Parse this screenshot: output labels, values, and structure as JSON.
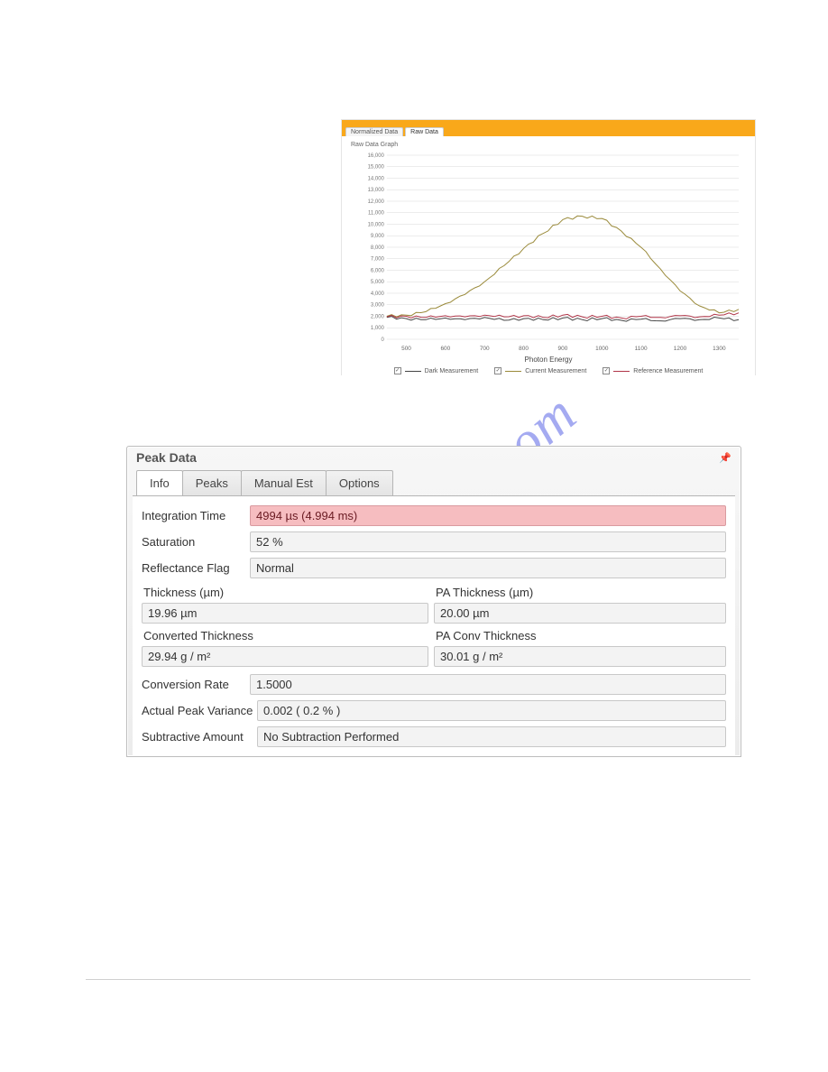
{
  "watermark_text": "manualshive.com",
  "chart_panel": {
    "tabs": [
      {
        "label": "Normalized Data",
        "active": false
      },
      {
        "label": "Raw Data",
        "active": true
      }
    ],
    "subtitle": "Raw Data Graph",
    "xlabel": "Photon Energy",
    "legend": [
      {
        "label": "Dark Measurement",
        "color": "#444444"
      },
      {
        "label": "Current Measurement",
        "color": "#9a8a3a"
      },
      {
        "label": "Reference Measurement",
        "color": "#b03548"
      }
    ]
  },
  "chart_data": {
    "type": "line",
    "title": "Raw Data Graph",
    "xlabel": "Photon Energy",
    "ylabel": "",
    "xlim": [
      450,
      1350
    ],
    "ylim": [
      0,
      16000
    ],
    "y_ticks": [
      0,
      1000,
      2000,
      3000,
      4000,
      5000,
      6000,
      7000,
      8000,
      9000,
      10000,
      11000,
      12000,
      13000,
      14000,
      15000,
      16000
    ],
    "x_ticks": [
      500,
      600,
      700,
      800,
      900,
      1000,
      1100,
      1200,
      1300
    ],
    "series": [
      {
        "name": "Dark Measurement",
        "color": "#444444",
        "x": [
          450,
          500,
          550,
          600,
          650,
          700,
          750,
          800,
          850,
          900,
          950,
          1000,
          1050,
          1100,
          1150,
          1200,
          1250,
          1300,
          1350
        ],
        "values": [
          1900,
          1800,
          1700,
          1850,
          1700,
          1900,
          1650,
          1800,
          1700,
          1850,
          1700,
          1800,
          1650,
          1750,
          1600,
          1800,
          1700,
          1850,
          1700
        ]
      },
      {
        "name": "Current Measurement",
        "color": "#9a8a3a",
        "x": [
          450,
          500,
          550,
          600,
          650,
          700,
          750,
          800,
          850,
          900,
          950,
          1000,
          1050,
          1100,
          1150,
          1200,
          1250,
          1300,
          1350
        ],
        "values": [
          2000,
          2100,
          2400,
          3100,
          3900,
          5000,
          6400,
          7900,
          9200,
          10400,
          10700,
          10500,
          9400,
          8000,
          6100,
          4200,
          2900,
          2300,
          2600
        ]
      },
      {
        "name": "Reference Measurement",
        "color": "#b03548",
        "x": [
          450,
          500,
          550,
          600,
          650,
          700,
          750,
          800,
          850,
          900,
          950,
          1000,
          1050,
          1100,
          1150,
          1200,
          1250,
          1300,
          1350
        ],
        "values": [
          1950,
          2000,
          1900,
          2050,
          1950,
          2100,
          1950,
          2050,
          1900,
          2100,
          1950,
          2000,
          1850,
          2000,
          1900,
          2050,
          1950,
          2100,
          2300
        ]
      }
    ]
  },
  "peak_panel": {
    "title": "Peak Data",
    "tabs": [
      {
        "label": "Info",
        "active": true
      },
      {
        "label": "Peaks",
        "active": false
      },
      {
        "label": "Manual Est",
        "active": false
      },
      {
        "label": "Options",
        "active": false
      }
    ],
    "info": {
      "integration_time_label": "Integration Time",
      "integration_time_value": "4994 µs   (4.994 ms)",
      "saturation_label": "Saturation",
      "saturation_value": "52 %",
      "reflectance_flag_label": "Reflectance Flag",
      "reflectance_flag_value": "Normal",
      "thickness_label": "Thickness (µm)",
      "thickness_value": "19.96 µm",
      "pa_thickness_label": "PA Thickness (µm)",
      "pa_thickness_value": "20.00 µm",
      "conv_thickness_label": "Converted Thickness",
      "conv_thickness_value": "29.94 g / m²",
      "pa_conv_thickness_label": "PA Conv Thickness",
      "pa_conv_thickness_value": "30.01 g / m²",
      "conversion_rate_label": "Conversion Rate",
      "conversion_rate_value": "1.5000",
      "actual_peak_variance_label": "Actual Peak Variance",
      "actual_peak_variance_value": "0.002 ( 0.2 % )",
      "subtractive_amount_label": "Subtractive Amount",
      "subtractive_amount_value": "No Subtraction Performed"
    }
  }
}
